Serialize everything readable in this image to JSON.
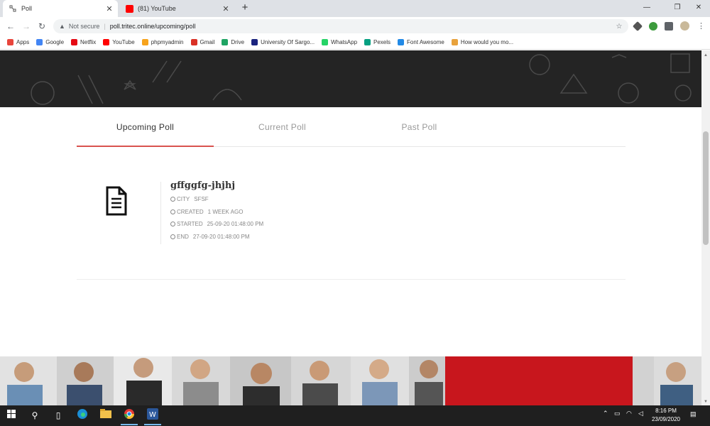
{
  "browser": {
    "tabs": [
      {
        "title": "Poll",
        "active": true
      },
      {
        "title": "(81) YouTube",
        "active": false
      }
    ],
    "address": {
      "security": "Not secure",
      "url": "poll.tritec.online/upcoming/poll"
    },
    "bookmarks": [
      {
        "label": "Apps",
        "icon": "apps-grid-icon",
        "color": "#e8453c"
      },
      {
        "label": "Google",
        "icon": "google-icon",
        "color": "#4285f4"
      },
      {
        "label": "Netflix",
        "icon": "netflix-icon",
        "color": "#e50914"
      },
      {
        "label": "YouTube",
        "icon": "youtube-icon",
        "color": "#ff0000"
      },
      {
        "label": "phpmyadmin",
        "icon": "phpmyadmin-icon",
        "color": "#f7a31c"
      },
      {
        "label": "Gmail",
        "icon": "gmail-icon",
        "color": "#d93025"
      },
      {
        "label": "Drive",
        "icon": "drive-icon",
        "color": "#1fa463"
      },
      {
        "label": "University Of Sargo...",
        "icon": "university-icon",
        "color": "#1a237e"
      },
      {
        "label": "WhatsApp",
        "icon": "whatsapp-icon",
        "color": "#25d366"
      },
      {
        "label": "Pexels",
        "icon": "pexels-icon",
        "color": "#05a081"
      },
      {
        "label": "Font Awesome",
        "icon": "font-awesome-icon",
        "color": "#228ae6"
      },
      {
        "label": "How would you mo...",
        "icon": "quora-icon",
        "color": "#e8a23c"
      }
    ]
  },
  "page": {
    "tabs": [
      {
        "label": "Upcoming Poll",
        "active": true
      },
      {
        "label": "Current Poll",
        "active": false
      },
      {
        "label": "Past Poll",
        "active": false
      }
    ],
    "accent_color": "#d9534f",
    "poll": {
      "title": "gffggfg-jhjhj",
      "meta": [
        {
          "label": "City",
          "value": "SFSF"
        },
        {
          "label": "Created",
          "value": "1 WEEK AGO"
        },
        {
          "label": "Started",
          "value": "25-09-20 01:48:00 PM"
        },
        {
          "label": "End",
          "value": "27-09-20 01:48:00 PM"
        }
      ]
    }
  },
  "taskbar": {
    "time": "8:16 PM",
    "date": "23/09/2020"
  }
}
